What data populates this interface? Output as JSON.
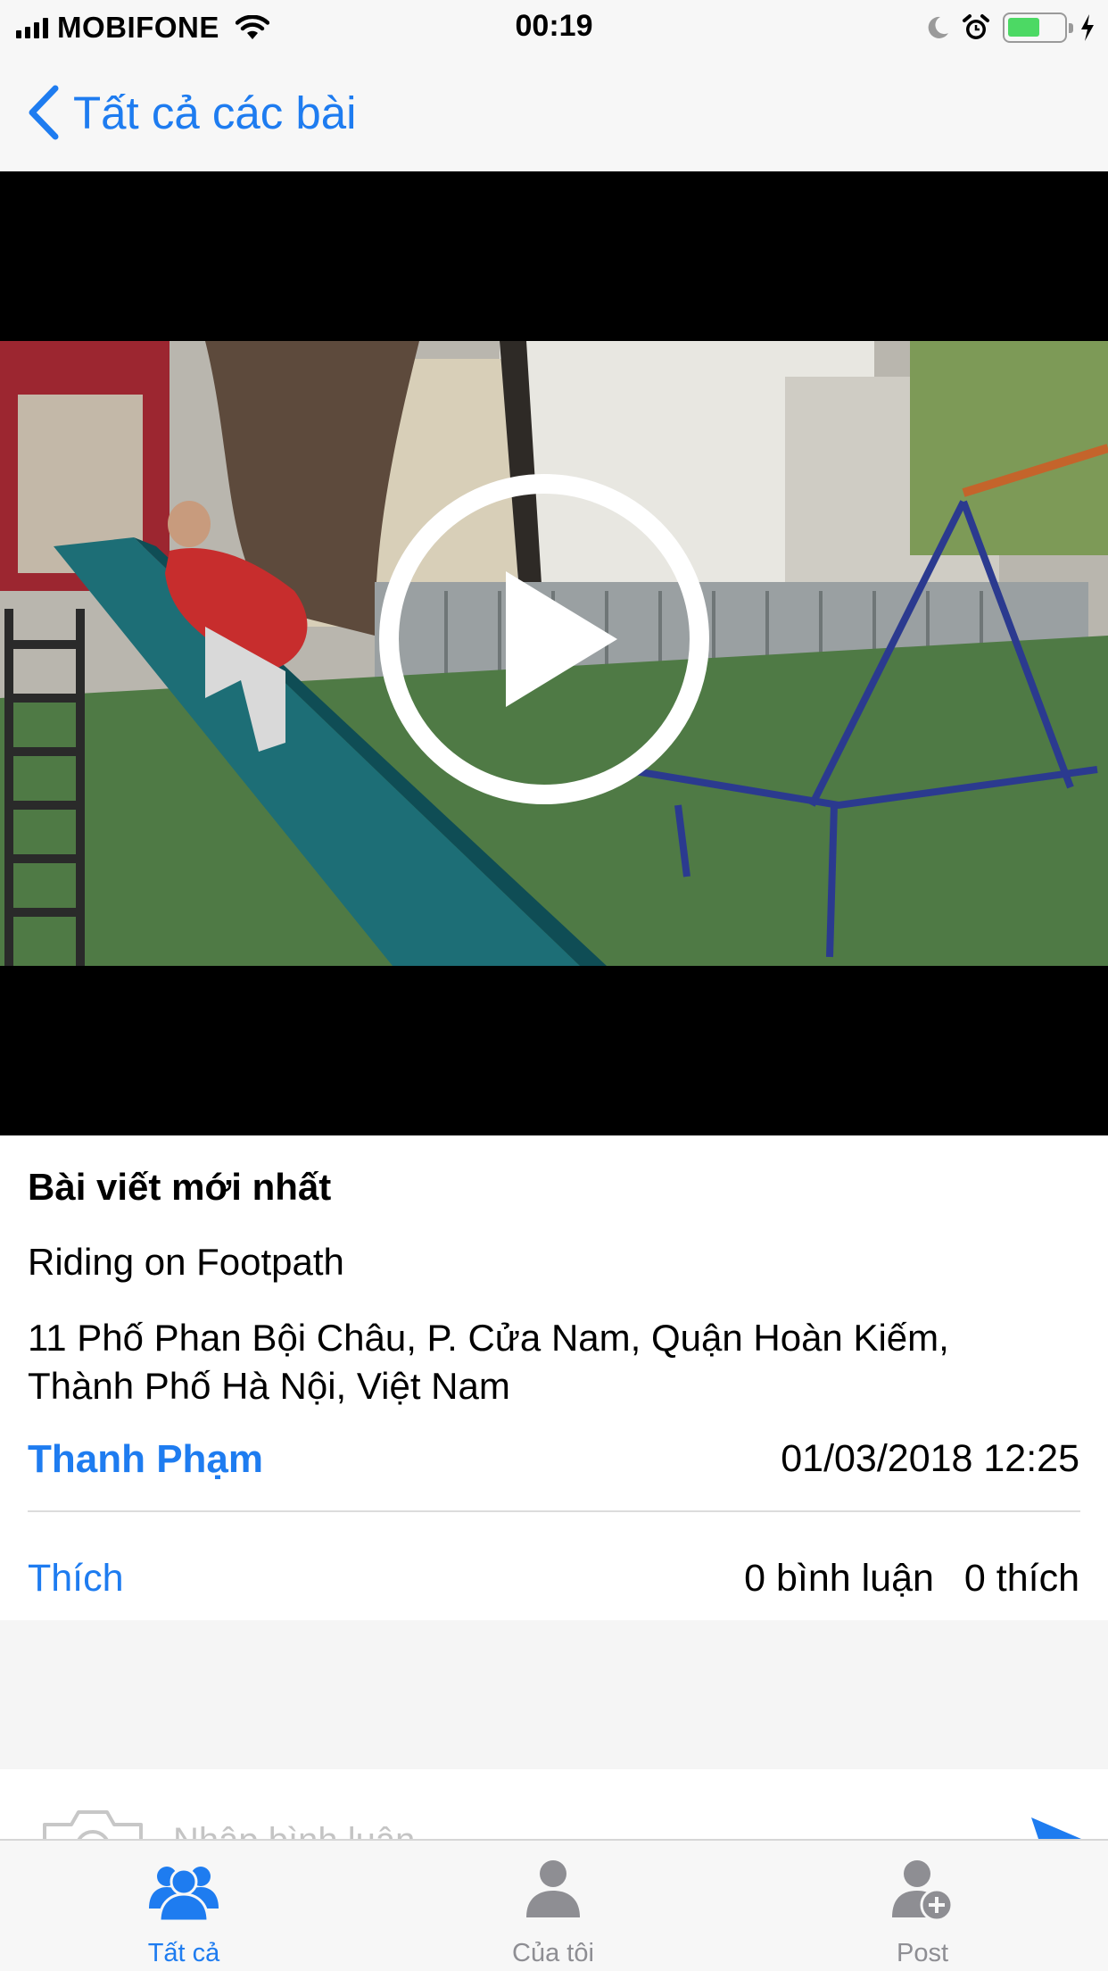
{
  "status_bar": {
    "carrier": "MOBIFONE",
    "time": "00:19",
    "battery_level": 0.52,
    "icons": [
      "signal-icon",
      "wifi-icon",
      "moon-icon",
      "alarm-icon",
      "battery-icon",
      "charging-icon"
    ]
  },
  "nav": {
    "back_label": "Tất cả các bài",
    "back_icon": "chevron-left-icon",
    "accent_color": "#1e7cf0"
  },
  "video": {
    "play_icon": "play-icon"
  },
  "post": {
    "heading": "Bài viết mới nhất",
    "title": "Riding on Footpath",
    "address": "11 Phố Phan Bội Châu, P. Cửa Nam, Quận Hoàn Kiếm, Thành Phố Hà Nội, Việt Nam",
    "author": "Thanh Phạm",
    "datetime": "01/03/2018 12:25",
    "like_label": "Thích",
    "comments_count": "0 bình luận",
    "likes_count": "0 thích"
  },
  "comment_bar": {
    "placeholder": "Nhập bình luận",
    "camera_icon": "camera-icon",
    "send_icon": "send-icon"
  },
  "tabs": [
    {
      "label": "Tất cả",
      "icon": "group-icon",
      "active": true
    },
    {
      "label": "Của tôi",
      "icon": "person-icon",
      "active": false
    },
    {
      "label": "Post",
      "icon": "add-person-icon",
      "active": false
    }
  ]
}
